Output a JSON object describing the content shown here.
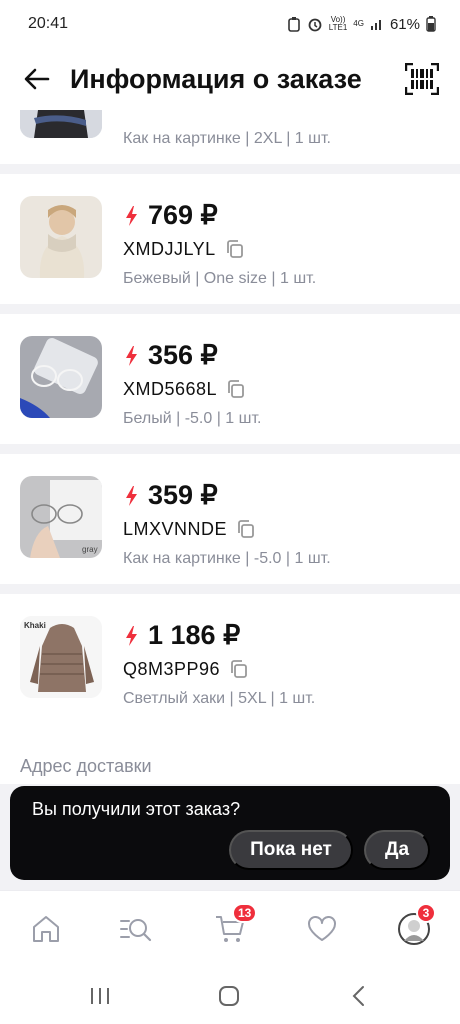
{
  "status_bar": {
    "time": "20:41",
    "net_top": "Vo))",
    "net_bottom": "LTE1",
    "net_type": "4G",
    "battery": "61%"
  },
  "header": {
    "title": "Информация о заказе"
  },
  "items": [
    {
      "price": "",
      "sku": "",
      "variant": "Как на картинке | 2XL | 1 шт."
    },
    {
      "price": "769 ₽",
      "sku": "XMDJJLYL",
      "variant": "Бежевый | One size | 1 шт."
    },
    {
      "price": "356 ₽",
      "sku": "XMD5668L",
      "variant": "Белый | -5.0 | 1 шт."
    },
    {
      "price": "359 ₽",
      "sku": "LMXVNNDE",
      "variant": "Как на картинке | -5.0 | 1 шт.",
      "thumb_label": "gray"
    },
    {
      "price": "1 186 ₽",
      "sku": "Q8M3PP96",
      "variant": "Светлый хаки | 5XL | 1 шт.",
      "thumb_label": "Khaki"
    }
  ],
  "address": {
    "label": "Адрес доставки"
  },
  "toast": {
    "question": "Вы получили этот заказ?",
    "not_yet": "Пока нет",
    "yes": "Да"
  },
  "bottom_nav": {
    "cart_badge": "13",
    "profile_badge": "3"
  },
  "colors": {
    "accent_red": "#ef2f3c",
    "muted_text": "#8a8d99",
    "toast_bg": "#0b0b0d"
  },
  "icons": [
    "arrow-left-icon",
    "barcode-icon",
    "lightning-icon",
    "copy-icon",
    "home-icon",
    "catalog-search-icon",
    "cart-icon",
    "heart-icon",
    "avatar",
    "recent-apps-icon",
    "home-circle-icon",
    "back-chevron-icon"
  ]
}
